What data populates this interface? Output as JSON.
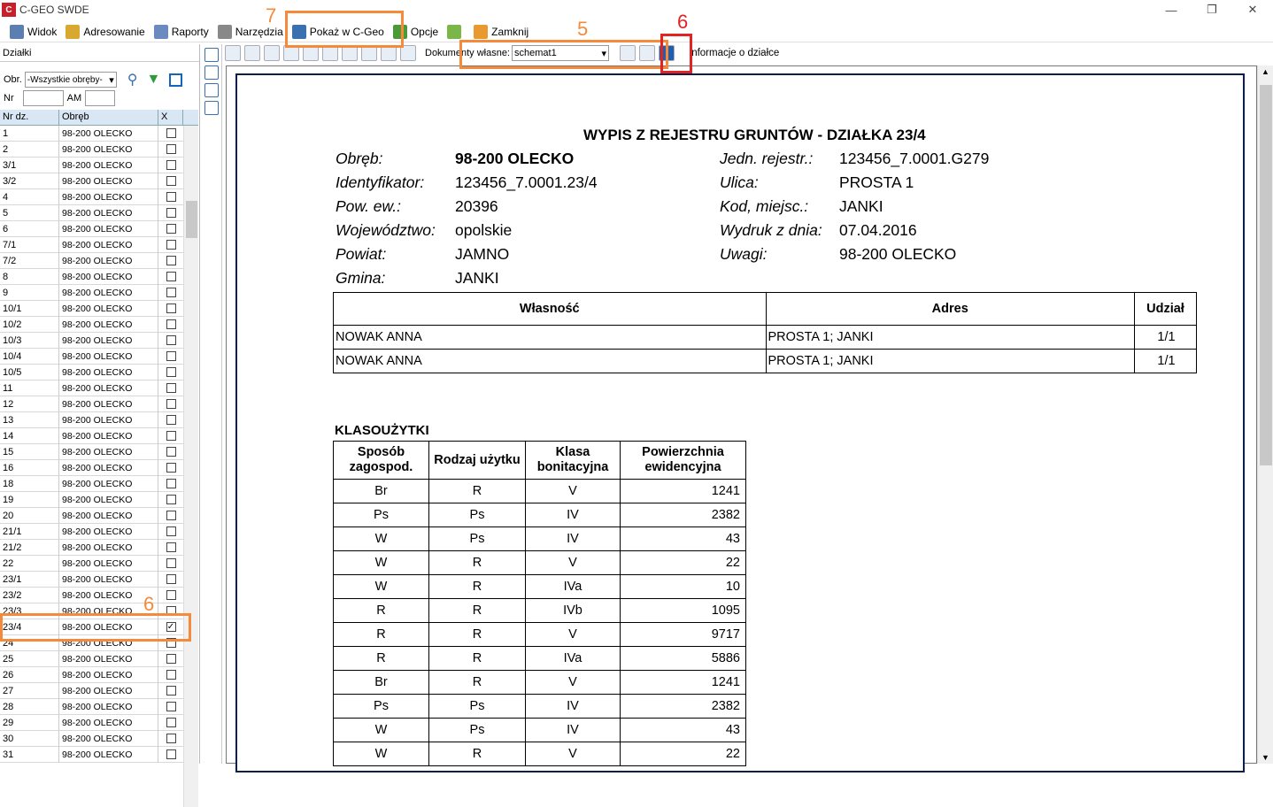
{
  "window": {
    "title": "C-GEO SWDE",
    "icon_text": "C"
  },
  "menu": [
    {
      "label": "Widok",
      "icon": "eye-icon"
    },
    {
      "label": "Adresowanie",
      "icon": "envelope-icon"
    },
    {
      "label": "Raporty",
      "icon": "report-icon"
    },
    {
      "label": "Narzędzia",
      "icon": "tools-icon"
    },
    {
      "label": "Pokaż w C-Geo",
      "icon": "map-icon"
    },
    {
      "label": "Opcje",
      "icon": "gear-icon"
    },
    {
      "label": "",
      "icon": "android-icon"
    },
    {
      "label": "Zamknij",
      "icon": "close-icon"
    }
  ],
  "left": {
    "title": "Działki",
    "obr_label": "Obr.",
    "obr_value": "-Wszystkie obręby-",
    "nr_label": "Nr",
    "am_label": "AM",
    "columns": [
      "Nr dz.",
      "Obręb",
      "X"
    ],
    "rows": [
      {
        "nr": "1",
        "obr": "98-200 OLECKO",
        "checked": false
      },
      {
        "nr": "2",
        "obr": "98-200 OLECKO",
        "checked": false
      },
      {
        "nr": "3/1",
        "obr": "98-200 OLECKO",
        "checked": false
      },
      {
        "nr": "3/2",
        "obr": "98-200 OLECKO",
        "checked": false
      },
      {
        "nr": "4",
        "obr": "98-200 OLECKO",
        "checked": false
      },
      {
        "nr": "5",
        "obr": "98-200 OLECKO",
        "checked": false
      },
      {
        "nr": "6",
        "obr": "98-200 OLECKO",
        "checked": false
      },
      {
        "nr": "7/1",
        "obr": "98-200 OLECKO",
        "checked": false
      },
      {
        "nr": "7/2",
        "obr": "98-200 OLECKO",
        "checked": false
      },
      {
        "nr": "8",
        "obr": "98-200 OLECKO",
        "checked": false
      },
      {
        "nr": "9",
        "obr": "98-200 OLECKO",
        "checked": false
      },
      {
        "nr": "10/1",
        "obr": "98-200 OLECKO",
        "checked": false
      },
      {
        "nr": "10/2",
        "obr": "98-200 OLECKO",
        "checked": false
      },
      {
        "nr": "10/3",
        "obr": "98-200 OLECKO",
        "checked": false
      },
      {
        "nr": "10/4",
        "obr": "98-200 OLECKO",
        "checked": false
      },
      {
        "nr": "10/5",
        "obr": "98-200 OLECKO",
        "checked": false
      },
      {
        "nr": "11",
        "obr": "98-200 OLECKO",
        "checked": false
      },
      {
        "nr": "12",
        "obr": "98-200 OLECKO",
        "checked": false
      },
      {
        "nr": "13",
        "obr": "98-200 OLECKO",
        "checked": false
      },
      {
        "nr": "14",
        "obr": "98-200 OLECKO",
        "checked": false
      },
      {
        "nr": "15",
        "obr": "98-200 OLECKO",
        "checked": false
      },
      {
        "nr": "16",
        "obr": "98-200 OLECKO",
        "checked": false
      },
      {
        "nr": "18",
        "obr": "98-200 OLECKO",
        "checked": false
      },
      {
        "nr": "19",
        "obr": "98-200 OLECKO",
        "checked": false
      },
      {
        "nr": "20",
        "obr": "98-200 OLECKO",
        "checked": false
      },
      {
        "nr": "21/1",
        "obr": "98-200 OLECKO",
        "checked": false
      },
      {
        "nr": "21/2",
        "obr": "98-200 OLECKO",
        "checked": false
      },
      {
        "nr": "22",
        "obr": "98-200 OLECKO",
        "checked": false
      },
      {
        "nr": "23/1",
        "obr": "98-200 OLECKO",
        "checked": false
      },
      {
        "nr": "23/2",
        "obr": "98-200 OLECKO",
        "checked": false
      },
      {
        "nr": "23/3",
        "obr": "98-200 OLECKO",
        "checked": false
      },
      {
        "nr": "23/4",
        "obr": "98-200 OLECKO",
        "checked": true
      },
      {
        "nr": "24",
        "obr": "98-200 OLECKO",
        "checked": false
      },
      {
        "nr": "25",
        "obr": "98-200 OLECKO",
        "checked": false
      },
      {
        "nr": "26",
        "obr": "98-200 OLECKO",
        "checked": false
      },
      {
        "nr": "27",
        "obr": "98-200 OLECKO",
        "checked": false
      },
      {
        "nr": "28",
        "obr": "98-200 OLECKO",
        "checked": false
      },
      {
        "nr": "29",
        "obr": "98-200 OLECKO",
        "checked": false
      },
      {
        "nr": "30",
        "obr": "98-200 OLECKO",
        "checked": false
      },
      {
        "nr": "31",
        "obr": "98-200 OLECKO",
        "checked": false
      }
    ]
  },
  "toolbar": {
    "doc_label": "Dokumenty własne:",
    "doc_value": "schemat1",
    "info_label": "Informacje o działce"
  },
  "report": {
    "title": "WYPIS Z REJESTRU GRUNTÓW - DZIAŁKA 23/4",
    "left_fields": [
      {
        "k": "Obręb:",
        "v": "98-200 OLECKO"
      },
      {
        "k": "Identyfikator:",
        "v": "123456_7.0001.23/4"
      },
      {
        "k": "Pow. ew.:",
        "v": "20396"
      },
      {
        "k": "Województwo:",
        "v": "opolskie"
      },
      {
        "k": "Powiat:",
        "v": "JAMNO"
      },
      {
        "k": "Gmina:",
        "v": "JANKI"
      }
    ],
    "right_fields": [
      {
        "k": "Jedn. rejestr.:",
        "v": "123456_7.0001.G279"
      },
      {
        "k": "Ulica:",
        "v": "PROSTA 1"
      },
      {
        "k": "Kod, miejsc.:",
        "v": "JANKI"
      },
      {
        "k": "Wydruk z dnia:",
        "v": "07.04.2016"
      },
      {
        "k": "Uwagi:",
        "v": "98-200 OLECKO"
      }
    ],
    "owners_headers": [
      "Własność",
      "Adres",
      "Udział"
    ],
    "owners": [
      [
        "NOWAK ANNA",
        "PROSTA 1; JANKI",
        "1/1"
      ],
      [
        "NOWAK ANNA",
        "PROSTA 1; JANKI",
        "1/1"
      ]
    ],
    "klas_title": "KLASOUŻYTKI",
    "klas_headers": [
      "Sposób zagospod.",
      "Rodzaj użytku",
      "Klasa bonitacyjna",
      "Powierzchnia ewidencyjna"
    ],
    "klas": [
      [
        "Br",
        "R",
        "V",
        "1241"
      ],
      [
        "Ps",
        "Ps",
        "IV",
        "2382"
      ],
      [
        "W",
        "Ps",
        "IV",
        "43"
      ],
      [
        "W",
        "R",
        "V",
        "22"
      ],
      [
        "W",
        "R",
        "IVa",
        "10"
      ],
      [
        "R",
        "R",
        "IVb",
        "1095"
      ],
      [
        "R",
        "R",
        "V",
        "9717"
      ],
      [
        "R",
        "R",
        "IVa",
        "5886"
      ],
      [
        "Br",
        "R",
        "V",
        "1241"
      ],
      [
        "Ps",
        "Ps",
        "IV",
        "2382"
      ],
      [
        "W",
        "Ps",
        "IV",
        "43"
      ],
      [
        "W",
        "R",
        "V",
        "22"
      ]
    ]
  },
  "annotations": {
    "a7": "7",
    "a5": "5",
    "a6_top": "6",
    "a6_left": "6"
  },
  "colors": {
    "annotation_orange": "#f58a3a",
    "annotation_red": "#e02424",
    "grid_header": "#d9e6f3",
    "page_border": "#0c1e4a"
  }
}
